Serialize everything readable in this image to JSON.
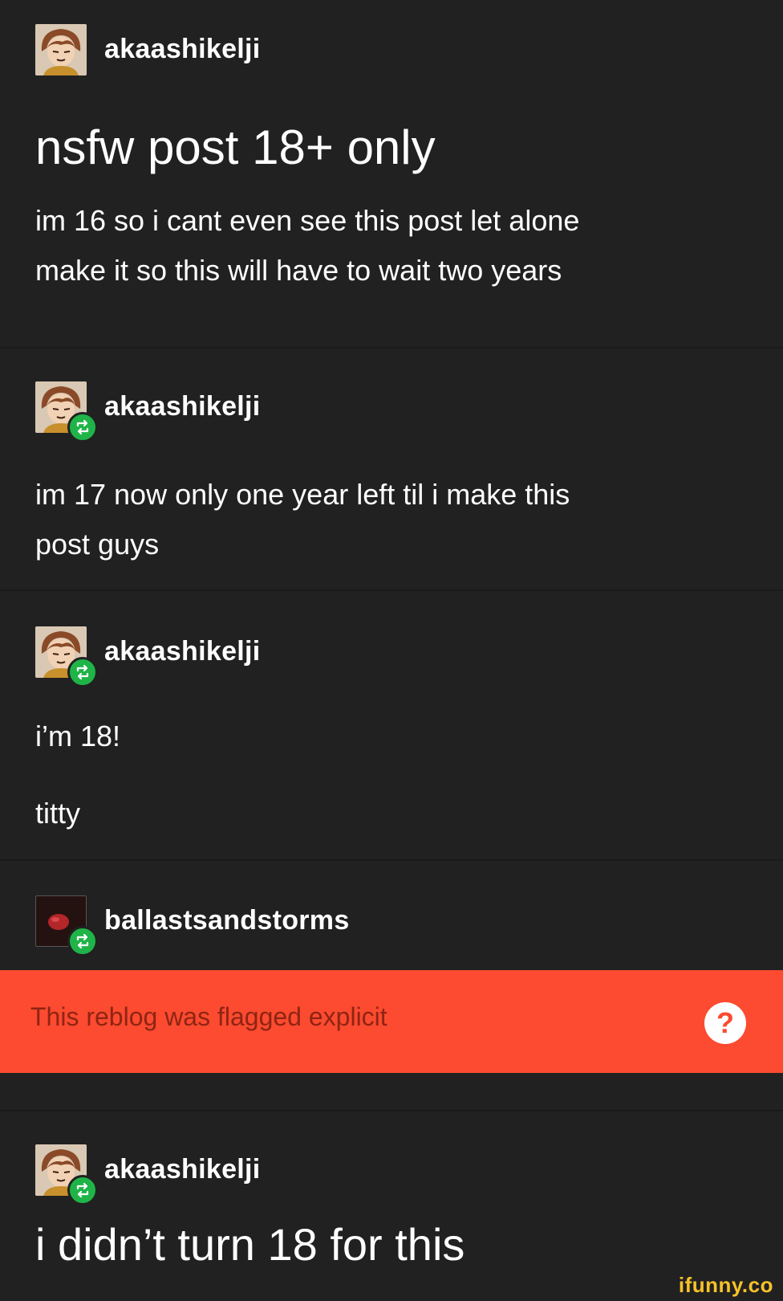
{
  "posts": [
    {
      "username": "akaashikelji",
      "title": "nsfw post 18+ only",
      "body": [
        "im 16 so i cant even see this post let alone",
        "make it so this will have to wait two years"
      ],
      "avatar_icon": "avatar-icon",
      "reblog": false
    },
    {
      "username": "akaashikelji",
      "body": [
        "im 17 now only one year left til i make this",
        "post guys"
      ],
      "avatar_icon": "avatar-icon",
      "reblog": true
    },
    {
      "username": "akaashikelji",
      "body": [
        "i’m 18!",
        "titty"
      ],
      "avatar_icon": "avatar-icon",
      "reblog": true
    },
    {
      "username": "ballastsandstorms",
      "avatar_icon": "avatar-icon",
      "reblog": true
    },
    {
      "username": "akaashikelji",
      "body": [
        "i didn’t turn 18 for this"
      ],
      "avatar_icon": "avatar-icon",
      "reblog": true
    }
  ],
  "flag_banner": {
    "text": "This reblog was flagged explicit",
    "help_glyph": "?"
  },
  "watermark": "ifunny.co",
  "colors": {
    "background": "#212121",
    "flag": "#fc4b30",
    "reblog": "#1fb448",
    "watermark": "#f6c22a"
  }
}
